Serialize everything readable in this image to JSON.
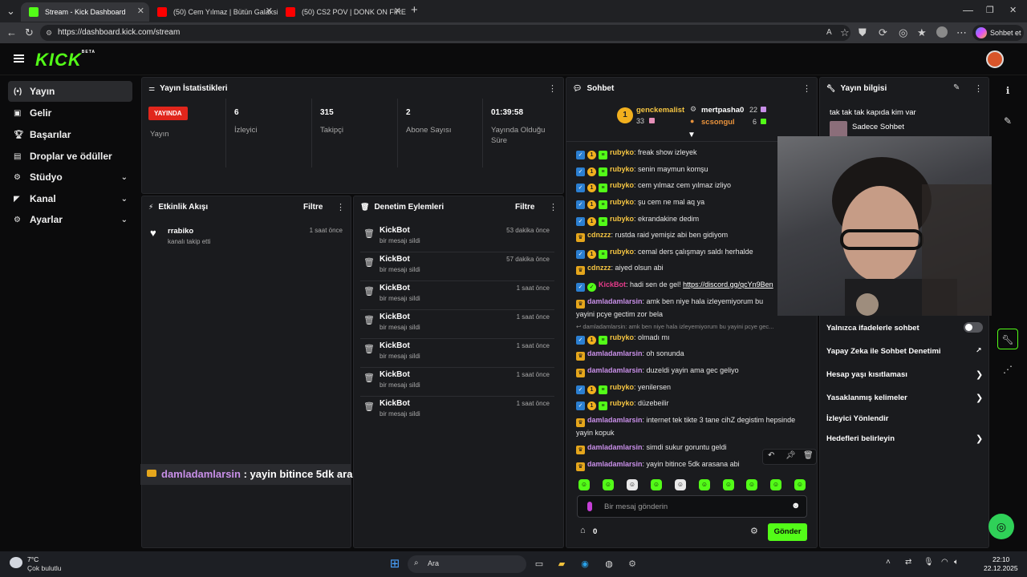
{
  "browser": {
    "tabs": [
      {
        "title": "Stream - Kick Dashboard",
        "active": true
      },
      {
        "title": "(50) Cem Yılmaz | Bütün Galaksi va",
        "active": false
      },
      {
        "title": "(50) CS2 POV | DONK ON FIRE🔥",
        "active": false
      }
    ],
    "url": "https://dashboard.kick.com/stream",
    "profile_button": "Sohbet et"
  },
  "brand": {
    "logo": "KICK",
    "beta": "BETA",
    "accent": "#53fc18"
  },
  "sidebar": {
    "items": [
      {
        "label": "Yayın",
        "icon": "broadcast-icon"
      },
      {
        "label": "Gelir",
        "icon": "wallet-icon"
      },
      {
        "label": "Başarılar",
        "icon": "trophy-icon"
      },
      {
        "label": "Droplar ve ödüller",
        "icon": "gift-icon"
      },
      {
        "label": "Stüdyo",
        "icon": "gear-icon"
      },
      {
        "label": "Kanal",
        "icon": "megaphone-icon"
      },
      {
        "label": "Ayarlar",
        "icon": "gear-icon"
      }
    ]
  },
  "stats": {
    "title": "Yayın İstatistikleri",
    "live_badge": "YAYINDA",
    "live_label": "Yayın",
    "cells": [
      {
        "value": "6",
        "label": "İzleyici"
      },
      {
        "value": "315",
        "label": "Takipçi"
      },
      {
        "value": "2",
        "label": "Abone Sayısı"
      },
      {
        "value": "01:39:58",
        "label": "Yayında Olduğu Süre"
      }
    ]
  },
  "activity": {
    "title": "Etkinlik Akışı",
    "filter": "Filtre",
    "items": [
      {
        "user": "rrabiko",
        "text": "kanalı takip etti",
        "time": "1 saat önce"
      }
    ]
  },
  "moderation": {
    "title": "Denetim Eylemleri",
    "filter": "Filtre",
    "rows": [
      {
        "who": "KickBot",
        "what": "bir mesajı sildi",
        "when": "53 dakika önce"
      },
      {
        "who": "KickBot",
        "what": "bir mesajı sildi",
        "when": "57 dakika önce"
      },
      {
        "who": "KickBot",
        "what": "bir mesajı sildi",
        "when": "1 saat önce"
      },
      {
        "who": "KickBot",
        "what": "bir mesajı sildi",
        "when": "1 saat önce"
      },
      {
        "who": "KickBot",
        "what": "bir mesajı sildi",
        "when": "1 saat önce"
      },
      {
        "who": "KickBot",
        "what": "bir mesajı sildi",
        "when": "1 saat önce"
      },
      {
        "who": "KickBot",
        "what": "bir mesajı sildi",
        "when": "1 saat önce"
      }
    ]
  },
  "chat": {
    "title": "Sohbet",
    "leaderboard": {
      "first_name": "genckemalist",
      "first_count": "33",
      "second_name": "mertpasha0",
      "second_count": "22",
      "third_name": "scsongul",
      "third_count": "6"
    },
    "messages": [
      {
        "user": "rubyko",
        "text": "freak show izleyek",
        "color": "#f5c542"
      },
      {
        "user": "rubyko",
        "text": "senin maymun komşu",
        "color": "#f5c542"
      },
      {
        "user": "rubyko",
        "text": "cem yılmaz cem yılmaz izliyo",
        "color": "#f5c542"
      },
      {
        "user": "rubyko",
        "text": "şu cem ne mal aq ya",
        "color": "#f5c542"
      },
      {
        "user": "rubyko",
        "text": "ekrandakine dedim",
        "color": "#f5c542"
      },
      {
        "user": "cdnzzz",
        "text": "rustda raid yemişiz abi ben gidiyom",
        "color": "#f5c542"
      },
      {
        "user": "rubyko",
        "text": "cemal ders çalışmayı saldı herhalde",
        "color": "#f5c542"
      },
      {
        "user": "cdnzzz",
        "text": "aiyed olsun abi",
        "color": "#f5c542"
      },
      {
        "user": "KickBot",
        "text": "hadi sen de gel! ",
        "link": "https://discord.gg/qcYn9Ben",
        "color": "#e63b8a"
      },
      {
        "user": "damladamlarsin",
        "text": "amk ben niye hala izleyemiyorum bu yayini pcye gectim zor bela",
        "color": "#c88fe8"
      },
      {
        "reply": "damladamlarsin: amk ben niye hala izleyemiyorum bu yayini pcye gec...",
        "user": "rubyko",
        "text": "olmadı mı",
        "color": "#f5c542"
      },
      {
        "user": "damladamlarsin",
        "text": "oh sonunda",
        "color": "#c88fe8"
      },
      {
        "user": "damladamlarsin",
        "text": "duzeldi yayin ama gec geliyo",
        "color": "#c88fe8"
      },
      {
        "user": "rubyko",
        "text": "yenilersen",
        "color": "#f5c542"
      },
      {
        "user": "rubyko",
        "text": "düzebeilir",
        "color": "#f5c542"
      },
      {
        "user": "damladamlarsin",
        "text": "internet tek tikte 3 tane cihZ degistim hepsinde yayin kopuk",
        "color": "#c88fe8"
      },
      {
        "user": "damladamlarsin",
        "text": "simdi sukur goruntu geldi",
        "color": "#c88fe8"
      },
      {
        "user": "damladamlarsin",
        "text": "yayin bitince 5dk arasana abi",
        "color": "#c88fe8"
      }
    ],
    "input_placeholder": "Bir mesaj gönderin",
    "points": "0",
    "send_label": "Gönder"
  },
  "stream_info": {
    "title": "Yayın bilgisi",
    "stream_title": "tak tak tak kapıda kim var",
    "category": "Sadece Sohbet"
  },
  "chat_settings": [
    {
      "label": "Yalnızca ifadelerle sohbet",
      "kind": "toggle",
      "on": false
    },
    {
      "label": "Yapay Zeka ile Sohbet Denetimi",
      "kind": "external"
    },
    {
      "label": "Hesap yaşı kısıtlaması",
      "kind": "arrow"
    },
    {
      "label": "Yasaklanmış kelimeler",
      "kind": "arrow"
    },
    {
      "label": "İzleyici Yönlendir",
      "kind": "none"
    },
    {
      "label": "Hedefleri belirleyin",
      "kind": "arrow"
    }
  ],
  "overlay": {
    "user": "damladamlarsin",
    "text": " : yayin bitince 5dk arasana abi"
  },
  "taskbar": {
    "weather_temp": "7°C",
    "weather_desc": "Çok bulutlu",
    "search_label": "Ara",
    "time": "22:10",
    "date": "22.12.2025"
  }
}
